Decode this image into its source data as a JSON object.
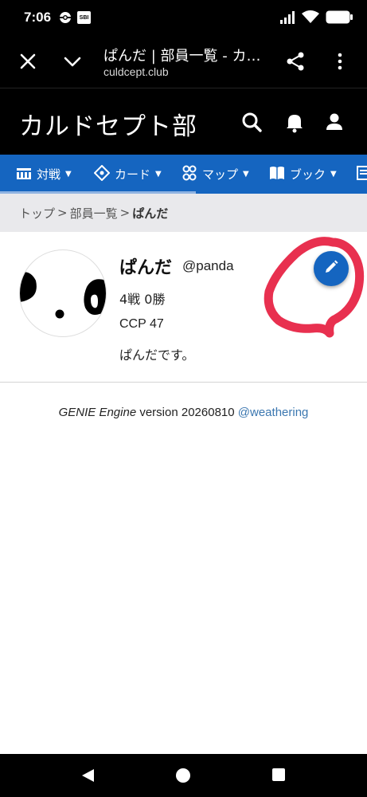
{
  "status_bar": {
    "time": "7:06",
    "sbi_badge": "SBI",
    "icons": [
      "pokeball-icon",
      "sbi-icon",
      "signal-icon",
      "wifi-icon",
      "battery-icon"
    ]
  },
  "browser": {
    "page_title": "ぱんだ | 部員一覧 - カ…",
    "url": "culdcept.club",
    "icons": [
      "close-icon",
      "chevron-down-icon",
      "share-icon",
      "more-vert-icon"
    ]
  },
  "site": {
    "title": "カルドセプト部",
    "header_icons": [
      "search-icon",
      "bell-icon",
      "user-icon"
    ]
  },
  "nav": {
    "items": [
      {
        "label": "対戦",
        "icon": "colosseum-icon"
      },
      {
        "label": "カード",
        "icon": "diamond-icon"
      },
      {
        "label": "マップ",
        "icon": "map-icon"
      },
      {
        "label": "ブック",
        "icon": "book-icon"
      }
    ]
  },
  "breadcrumb": {
    "items": [
      "トップ",
      "部員一覧",
      "ぱんだ"
    ],
    "separator": ">"
  },
  "profile": {
    "name": "ぱんだ",
    "handle": "@panda",
    "record": "4戦 0勝",
    "ccp": "CCP 47",
    "bio": "ぱんだです。"
  },
  "footer": {
    "engine": "GENIE Engine",
    "version": "version 20260810",
    "author": "@weathering"
  },
  "colors": {
    "nav_blue": "#1565c0",
    "header_black": "#000000",
    "breadcrumb_bg": "#e9e9ec",
    "link_blue": "#3b77b0",
    "annotation_red": "#e8304f"
  }
}
